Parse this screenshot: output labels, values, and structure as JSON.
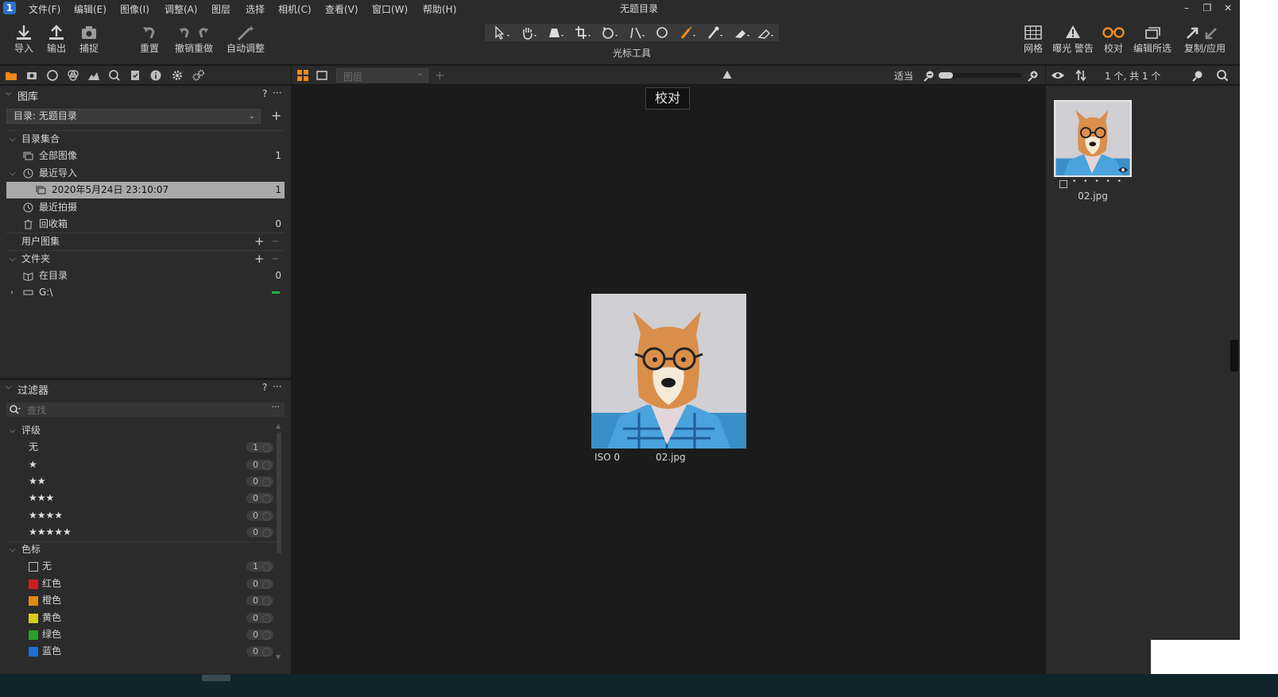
{
  "app": {
    "window_title": "无题目录",
    "menu": [
      "文件(F)",
      "编辑(E)",
      "图像(I)",
      "调整(A)",
      "图层",
      "选择",
      "相机(C)",
      "查看(V)",
      "窗口(W)",
      "帮助(H)"
    ]
  },
  "toolbar": {
    "import": "导入",
    "export": "输出",
    "capture": "捕捉",
    "reset": "重置",
    "undo_redo": "撤销重做",
    "auto_adjust": "自动调整",
    "cursor_tools": "光标工具",
    "grid": "网格",
    "exposure_warning": "曝光 警告",
    "proof": "校对",
    "edit_selected": "编辑所选",
    "copy_apply": "复制/应用"
  },
  "viewer_bar": {
    "layer_placeholder": "图层",
    "zoom_fit": "适当"
  },
  "browser_bar": {
    "count": "1 个, 共 1 个"
  },
  "library": {
    "title": "图库",
    "help": "?",
    "more": "···",
    "catalog": "目录: 无题目录",
    "collections_header": "目录集合",
    "all_images": "全部图像",
    "all_images_count": "1",
    "recent_imports": "最近导入",
    "import_entry": "2020年5月24日 23:10:07",
    "import_entry_count": "1",
    "recent_captures": "最近拍摄",
    "trash": "回收箱",
    "trash_count": "0",
    "user_collections": "用户图集",
    "folders": "文件夹",
    "in_catalog": "在目录",
    "in_catalog_count": "0",
    "drive": "G:\\"
  },
  "filters": {
    "title": "过滤器",
    "help": "?",
    "more": "···",
    "search_placeholder": "查找",
    "rating_header": "评级",
    "rating_none": "无",
    "ratings": [
      {
        "stars": "★",
        "count": "0"
      },
      {
        "stars": "★★",
        "count": "0"
      },
      {
        "stars": "★★★",
        "count": "0"
      },
      {
        "stars": "★★★★",
        "count": "0"
      },
      {
        "stars": "★★★★★",
        "count": "0"
      }
    ],
    "rating_none_count": "1",
    "color_header": "色标",
    "colors": [
      {
        "label": "无",
        "count": "1",
        "color": "none"
      },
      {
        "label": "红色",
        "count": "0",
        "color": "#d01c1c"
      },
      {
        "label": "橙色",
        "count": "0",
        "color": "#e08a12"
      },
      {
        "label": "黄色",
        "count": "0",
        "color": "#d8cc12"
      },
      {
        "label": "绿色",
        "count": "0",
        "color": "#28a028"
      },
      {
        "label": "蓝色",
        "count": "0",
        "color": "#1f6fd6"
      }
    ]
  },
  "viewer": {
    "proof_badge": "校对",
    "iso": "ISO 0",
    "filename": "02.jpg"
  },
  "browser": {
    "thumb_name": "02.jpg",
    "thumb_dots": "• • • • •"
  },
  "colors": {
    "accent_orange": "#f08a1c",
    "panel_bg": "#2b2b2b",
    "viewer_bg": "#1b1b1b"
  }
}
